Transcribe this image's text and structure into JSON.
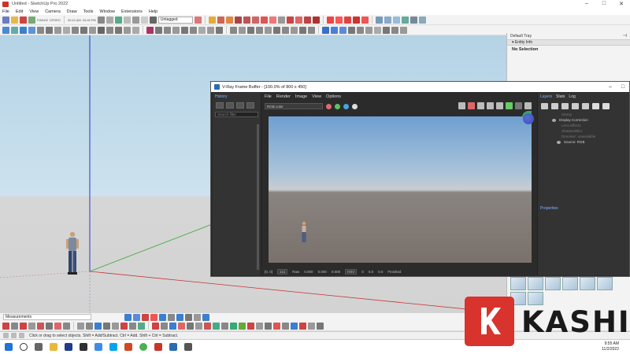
{
  "app": {
    "title": "Untitled - SketchUp Pro 2022",
    "window_buttons": [
      "–",
      "□",
      "✕"
    ]
  },
  "menu": [
    "File",
    "Edit",
    "View",
    "Camera",
    "Draw",
    "Tools",
    "Window",
    "Extensions",
    "Help"
  ],
  "toolbar": {
    "layer_value": "Untagged",
    "tiny_labels": [
      "FWAHZ",
      "DFDED",
      "00:42 AM",
      "04:45 PM"
    ]
  },
  "tray": {
    "header": "Default Tray",
    "pin_icon": "pin-icon",
    "panel": "▾ Entity Info",
    "selection": "No Selection"
  },
  "vfb": {
    "title": "V-Ray Frame Buffer - [100.0% of 800 x 450]",
    "window_buttons": [
      "–",
      "□"
    ],
    "menu": [
      "File",
      "Render",
      "Image",
      "View",
      "Options"
    ],
    "history_label": "History",
    "search_placeholder": "Search filter",
    "channel": "RGB color",
    "channel_dots": [
      "#e26b6b",
      "#5fc35f",
      "#4aa3e0"
    ],
    "status": {
      "coords": "[0, 0]",
      "zoom": "1x1",
      "raw_label": "Raw",
      "raw_values": [
        "0.000",
        "0.000",
        "0.000"
      ],
      "mode": "HSV",
      "hsv_values": [
        "0",
        "0.0",
        "0.0"
      ],
      "state": "Finished"
    },
    "right_tabs": [
      "Layers",
      "Stats",
      "Log"
    ],
    "layers": [
      {
        "label": "Stamp",
        "style": "dim"
      },
      {
        "label": "Display Correction",
        "style": "normal"
      },
      {
        "label": "Lens Effects",
        "style": "dim"
      },
      {
        "label": "Sharpen/Blur",
        "style": "dim"
      },
      {
        "label": "Denoiser: unavailable",
        "style": "dim"
      },
      {
        "label": "Source: RGB",
        "style": "sub"
      }
    ],
    "properties_label": "Properties"
  },
  "measurements": {
    "label": "Measurements"
  },
  "status_bar": {
    "message": "Click or drag to select objects. Shift = Add/Subtract. Ctrl = Add. Shift + Ctrl = Subtract."
  },
  "taskbar": {
    "time": "9:55 AM",
    "date": "11/2/2022"
  },
  "watermark": {
    "letter": "K",
    "word": "KASHI"
  },
  "colors": {
    "brand_red": "#d8332c",
    "vray_accent": "#7fb3ff"
  }
}
